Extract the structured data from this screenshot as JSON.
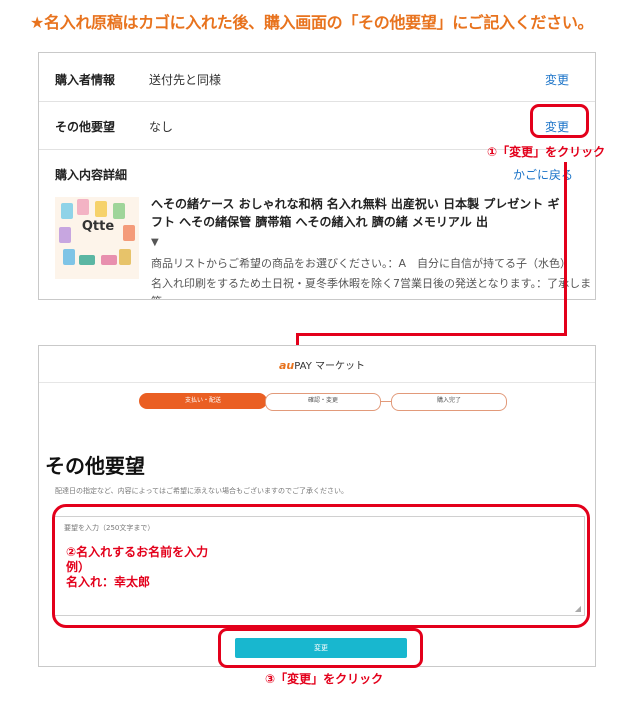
{
  "headline": "★名入れ原稿はカゴに入れた後、購入画面の「その他要望」にご記入ください。",
  "purchase_panel": {
    "rows": [
      {
        "label": "購入者情報",
        "value": "送付先と同様",
        "link": "変更"
      },
      {
        "label": "その他要望",
        "value": "なし",
        "link": "変更"
      }
    ],
    "details_label": "購入内容詳細",
    "back_link": "かごに戻る",
    "product": {
      "logo_text": "Qtte",
      "title": "へその緒ケース おしゃれな和柄 名入れ無料 出産祝い 日本製 プレゼント ギフト へその緒保管 臍帯箱 へその緒入れ 臍の緒 メモリアル 出",
      "toggle": "▼",
      "line1": "商品リストからご希望の商品をお選びください。：A　自分に自信が持てる子（水色）",
      "line2": "名入れ印刷をするため土日祝・夏冬季休暇を除く7営業日後の発送となります。：了承しま",
      "line3": "等"
    }
  },
  "annotations": {
    "step1": "①「変更」をクリック",
    "step3": "③「変更」をクリック"
  },
  "request_panel": {
    "brand_au": "au",
    "brand_rest": "PAY マーケット",
    "steps": [
      "支払い・配送",
      "確認・変更",
      "購入完了"
    ],
    "title": "その他要望",
    "note": "配達日の指定など、内容によってはご希望に添えない場合もございますのでご了承ください。",
    "textarea_label": "要望を入力（250文字まで）",
    "typed_lines": [
      "②名入れするお名前を入力",
      "例）",
      "名入れ：幸太郎"
    ],
    "resize_icon": "◢",
    "submit_label": "変更"
  },
  "colors": {
    "accent": "#e8731e",
    "annotation": "#e3001b",
    "link": "#1a73c8",
    "submit": "#18b7cf",
    "step_active": "#ea5f23"
  }
}
